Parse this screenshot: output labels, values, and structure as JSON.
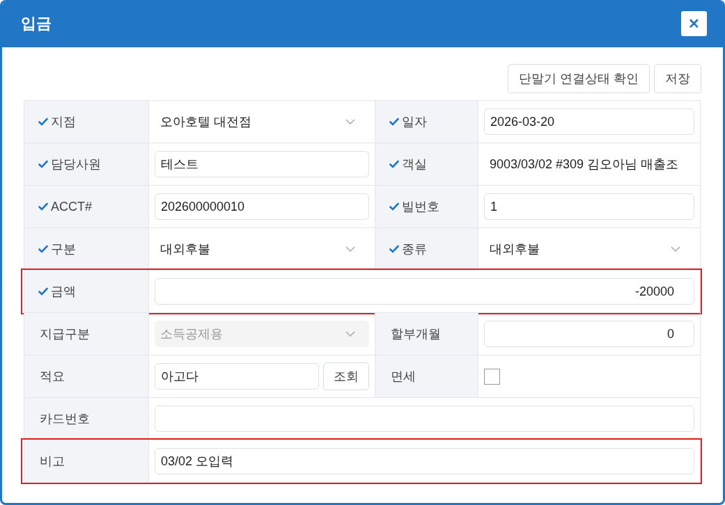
{
  "dialog": {
    "title": "입금",
    "close_label": "✕"
  },
  "toolbar": {
    "buttons": [
      "단말기 연결상태 확인",
      "저장"
    ]
  },
  "rows": [
    {
      "highlighted": false,
      "fields": [
        {
          "label": "지점",
          "required": true,
          "kind": "select",
          "value": "오아호텔 대전점",
          "disabled": false
        },
        {
          "label": "일자",
          "required": true,
          "kind": "input",
          "value": "2026-03-20"
        }
      ]
    },
    {
      "highlighted": false,
      "fields": [
        {
          "label": "담당사원",
          "required": true,
          "kind": "input",
          "value": "테스트"
        },
        {
          "label": "객실",
          "required": true,
          "kind": "text",
          "value": "9003/03/02 #309 김오아님 매출조"
        }
      ]
    },
    {
      "highlighted": false,
      "fields": [
        {
          "label": "ACCT#",
          "required": true,
          "kind": "input",
          "value": "202600000010"
        },
        {
          "label": "빌번호",
          "required": true,
          "kind": "input",
          "value": "1"
        }
      ]
    },
    {
      "highlighted": false,
      "fields": [
        {
          "label": "구분",
          "required": true,
          "kind": "select",
          "value": "대외후불",
          "disabled": false
        },
        {
          "label": "종류",
          "required": true,
          "kind": "select",
          "value": "대외후불",
          "disabled": false
        }
      ]
    },
    {
      "highlighted": true,
      "fields": [
        {
          "label": "금액",
          "required": true,
          "kind": "number",
          "value": "-20000"
        }
      ]
    },
    {
      "highlighted": false,
      "fields": [
        {
          "label": "지급구분",
          "required": false,
          "kind": "select",
          "value": "소득공제용",
          "disabled": true
        },
        {
          "label": "할부개월",
          "required": false,
          "kind": "number",
          "value": "0"
        }
      ]
    },
    {
      "highlighted": false,
      "fields": [
        {
          "label": "적요",
          "required": false,
          "kind": "lookup",
          "value": "아고다",
          "button": "조회"
        },
        {
          "label": "면세",
          "required": false,
          "kind": "checkbox",
          "checked": false
        }
      ]
    },
    {
      "highlighted": false,
      "fields": [
        {
          "label": "카드번호",
          "required": false,
          "kind": "input"
        }
      ]
    },
    {
      "highlighted": true,
      "fields": [
        {
          "label": "비고",
          "required": false,
          "kind": "input",
          "value": "03/02 오입력"
        }
      ]
    }
  ]
}
